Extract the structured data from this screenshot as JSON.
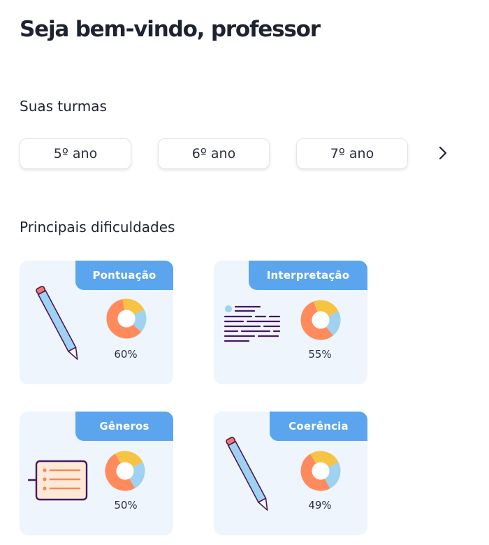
{
  "header": {
    "title": "Seja bem-vindo, professor"
  },
  "classes": {
    "label": "Suas turmas",
    "items": [
      {
        "label": "5º ano"
      },
      {
        "label": "6º ano"
      },
      {
        "label": "7º ano"
      }
    ],
    "next_icon": "chevron-right-icon"
  },
  "difficulties": {
    "label": "Principais dificuldades",
    "cards": [
      {
        "title": "Pontuação",
        "percent": "60%",
        "value": 0.6,
        "illustration": "pen-icon"
      },
      {
        "title": "Interpretação",
        "percent": "55%",
        "value": 0.55,
        "illustration": "text-lines-icon"
      },
      {
        "title": "Gêneros",
        "percent": "50%",
        "value": 0.5,
        "illustration": "list-board-icon"
      },
      {
        "title": "Coerência",
        "percent": "49%",
        "value": 0.49,
        "illustration": "pen-icon"
      }
    ]
  },
  "colors": {
    "tag_blue": "#5aa5ee",
    "card_bg": "#eef5fd",
    "donut_orange": "#ff8a5c",
    "donut_yellow": "#f7c342",
    "donut_blue": "#9fd2f0",
    "ink_purple": "#4a1762"
  }
}
